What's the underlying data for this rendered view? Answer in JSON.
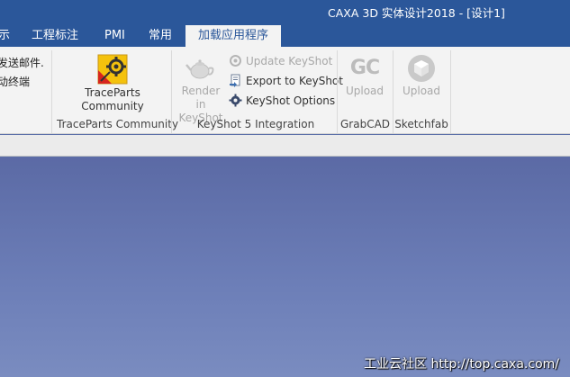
{
  "window": {
    "title": "CAXA 3D 实体设计2018 - [设计1]"
  },
  "tabs": [
    {
      "label": "示"
    },
    {
      "label": "工程标注"
    },
    {
      "label": "PMI"
    },
    {
      "label": "常用"
    },
    {
      "label": "加载应用程序",
      "active": true
    }
  ],
  "left_partial": {
    "line1": "发送邮件.",
    "line2": "动终端"
  },
  "groups": {
    "traceparts": {
      "button_line1": "TraceParts",
      "button_line2": "Community",
      "label": "TraceParts Community"
    },
    "keyshot": {
      "render_line1": "Render in",
      "render_line2": "KeyShot",
      "update": "Update KeyShot",
      "export": "Export to KeyShot",
      "options": "KeyShot Options",
      "label": "KeyShot 5 Integration"
    },
    "grabcad": {
      "upload": "Upload",
      "label": "GrabCAD",
      "icon_text": "GC"
    },
    "sketchfab": {
      "upload": "Upload",
      "label": "Sketchfab"
    }
  },
  "watermark": "工业云社区 http://top.caxa.com/",
  "colors": {
    "titlebar": "#2b579a",
    "ribbon": "#f3f3f3",
    "viewport_top": "#5b6aa5",
    "viewport_bottom": "#7a8cc0",
    "disabled_text": "#a8a8a8"
  },
  "icons": {
    "traceparts": "traceparts-gear-icon",
    "render": "teapot-icon",
    "update": "refresh-icon",
    "export": "export-document-icon",
    "options": "settings-gear-icon",
    "grabcad": "grabcad-logo-icon",
    "sketchfab": "sketchfab-cube-icon"
  }
}
